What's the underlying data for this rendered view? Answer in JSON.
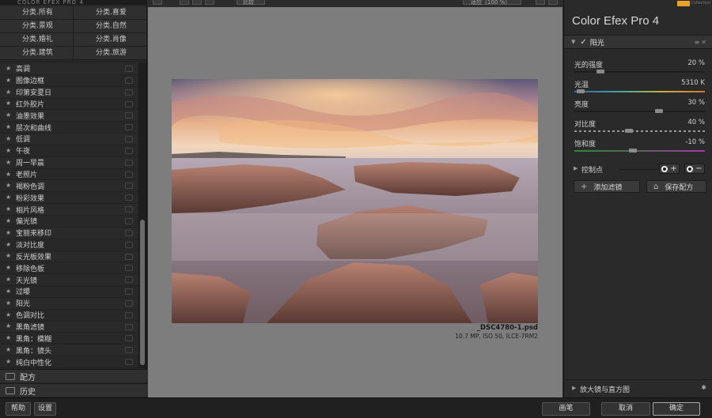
{
  "left_panel": {
    "title": "COLOR EFEX PRO 4",
    "categories": [
      "分类.所有",
      "分类.喜爱",
      "分类.景观",
      "分类.自然",
      "分类.婚礼",
      "分类.肖像",
      "分类.建筑",
      "分类.旅游"
    ],
    "filters": [
      "高调",
      "图像边框",
      "印第安夏日",
      "红外胶片",
      "油墨效果",
      "层次和曲线",
      "低调",
      "午夜",
      "周一早晨",
      "老照片",
      "褐粉色调",
      "粉彩效果",
      "相片风格",
      "偏光镜",
      "宝丽来移印",
      "淡对比度",
      "反光板效果",
      "移除色板",
      "天光镜",
      "过曝",
      "阳光",
      "色调对比",
      "黑角滤镜",
      "黑角：模糊",
      "黑角：镜头",
      "纯白中性化"
    ],
    "recipes_label": "配方",
    "history_label": "历史"
  },
  "toolbar": {
    "compare_label": "比较",
    "zoom_label": "适应（100 %）"
  },
  "photo": {
    "filename": "_DSC4780-1.psd",
    "meta": "10.7 MP, ISO 50, ILCE-7RM2"
  },
  "right_panel": {
    "brand_collection": "Collection",
    "app_title": "Color Efex Pro",
    "app_version": "4",
    "filter_name": "阳光",
    "sliders": [
      {
        "label": "光的强度",
        "value": "20 %",
        "level": 0.2,
        "track": "plain"
      },
      {
        "label": "光温",
        "value": "5310 K",
        "level": 0.05,
        "track": "temp"
      },
      {
        "label": "亮度",
        "value": "30 %",
        "level": 0.65,
        "track": "plain"
      },
      {
        "label": "对比度",
        "value": "40 %",
        "level": 0.42,
        "track": "dashed"
      },
      {
        "label": "饱和度",
        "value": "-10 %",
        "level": 0.45,
        "track": "tint"
      }
    ],
    "control_points_label": "控制点",
    "add_filter_label": "添加滤镜",
    "save_recipe_label": "保存配方",
    "loupe_label": "放大镜与直方图"
  },
  "bottom_bar": {
    "help_label": "帮助",
    "settings_label": "设置",
    "brush_label": "画笔",
    "cancel_label": "取消",
    "ok_label": "确定"
  }
}
